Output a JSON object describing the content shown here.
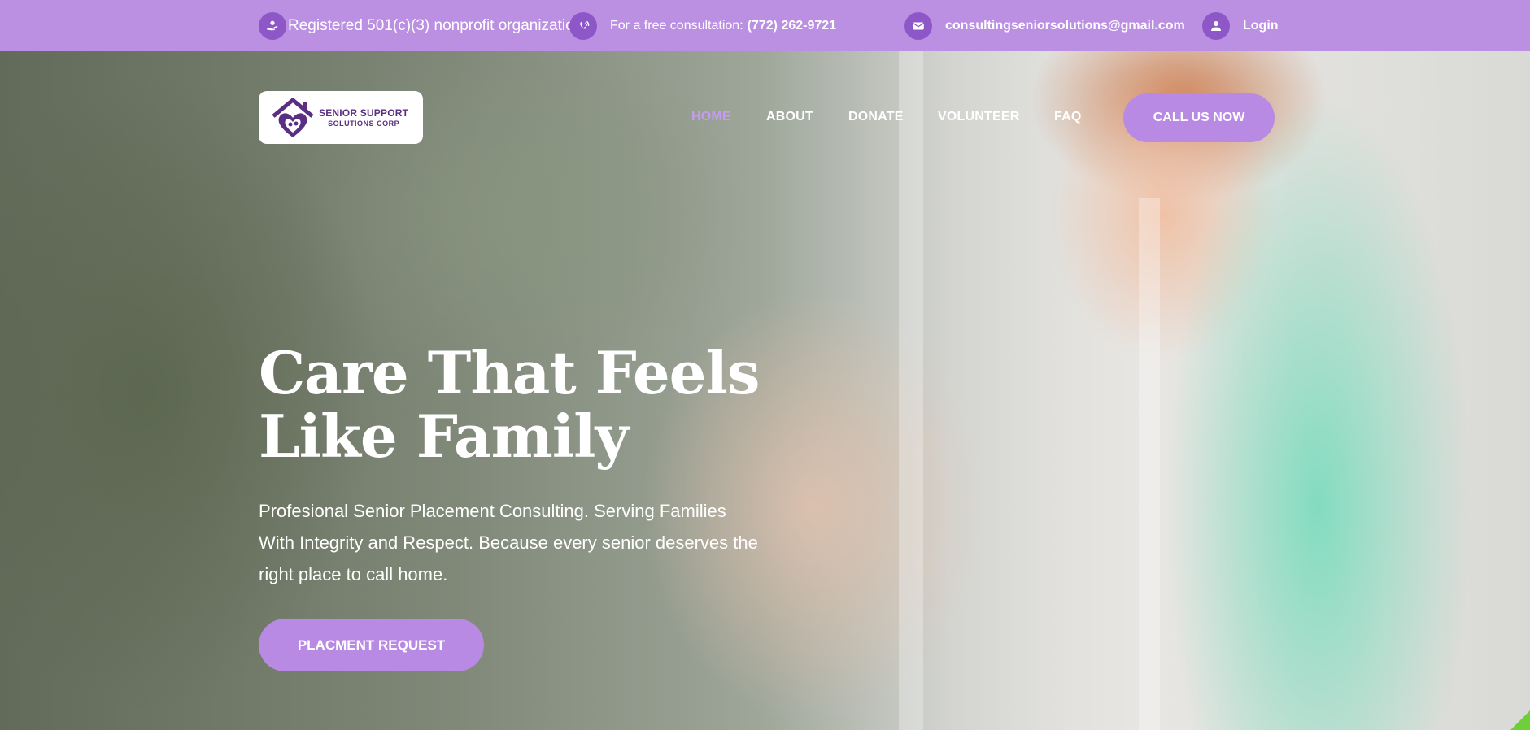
{
  "topbar": {
    "nonprofit_text": "Registered 501(c)(3) nonprofit organization",
    "consult_label": "For a free consultation:",
    "phone": "(772) 262-9721",
    "email": "consultingseniorsolutions@gmail.com",
    "login_label": "Login",
    "icons": [
      "hand-heart-icon",
      "phone-icon",
      "mail-icon",
      "user-icon"
    ]
  },
  "logo": {
    "line1": "SENIOR SUPPORT",
    "line2": "SOLUTIONS CORP"
  },
  "nav": {
    "items": [
      {
        "label": "HOME",
        "active": true
      },
      {
        "label": "ABOUT",
        "active": false
      },
      {
        "label": "DONATE",
        "active": false
      },
      {
        "label": "VOLUNTEER",
        "active": false
      },
      {
        "label": "FAQ",
        "active": false
      }
    ],
    "cta_label": "CALL US NOW"
  },
  "hero": {
    "headline_line1": "Care That Feels",
    "headline_line2": "Like Family",
    "subtext": "Profesional Senior Placement Consulting. Serving Families With Integrity and Respect. Because every senior deserves the right place to call home.",
    "cta_label": "PLACMENT REQUEST"
  },
  "colors": {
    "brand_purple": "#bb90e2",
    "icon_purple": "#8e57c8",
    "nav_active": "#c59cf0",
    "button_purple": "#b98ae3",
    "logo_purple": "#5a2e82"
  }
}
